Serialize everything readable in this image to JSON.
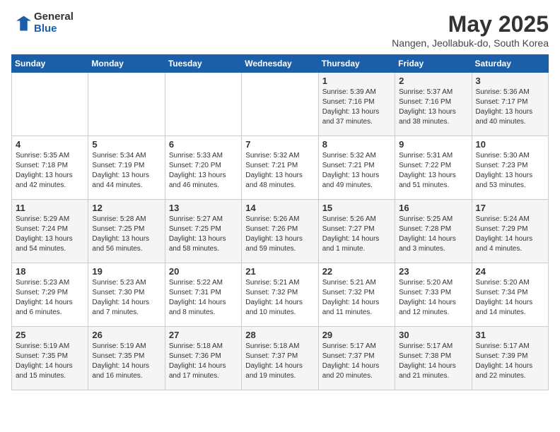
{
  "logo": {
    "general": "General",
    "blue": "Blue"
  },
  "title": "May 2025",
  "subtitle": "Nangen, Jeollabuk-do, South Korea",
  "days_header": [
    "Sunday",
    "Monday",
    "Tuesday",
    "Wednesday",
    "Thursday",
    "Friday",
    "Saturday"
  ],
  "weeks": [
    [
      {
        "day": "",
        "info": ""
      },
      {
        "day": "",
        "info": ""
      },
      {
        "day": "",
        "info": ""
      },
      {
        "day": "",
        "info": ""
      },
      {
        "day": "1",
        "info": "Sunrise: 5:39 AM\nSunset: 7:16 PM\nDaylight: 13 hours\nand 37 minutes."
      },
      {
        "day": "2",
        "info": "Sunrise: 5:37 AM\nSunset: 7:16 PM\nDaylight: 13 hours\nand 38 minutes."
      },
      {
        "day": "3",
        "info": "Sunrise: 5:36 AM\nSunset: 7:17 PM\nDaylight: 13 hours\nand 40 minutes."
      }
    ],
    [
      {
        "day": "4",
        "info": "Sunrise: 5:35 AM\nSunset: 7:18 PM\nDaylight: 13 hours\nand 42 minutes."
      },
      {
        "day": "5",
        "info": "Sunrise: 5:34 AM\nSunset: 7:19 PM\nDaylight: 13 hours\nand 44 minutes."
      },
      {
        "day": "6",
        "info": "Sunrise: 5:33 AM\nSunset: 7:20 PM\nDaylight: 13 hours\nand 46 minutes."
      },
      {
        "day": "7",
        "info": "Sunrise: 5:32 AM\nSunset: 7:21 PM\nDaylight: 13 hours\nand 48 minutes."
      },
      {
        "day": "8",
        "info": "Sunrise: 5:32 AM\nSunset: 7:21 PM\nDaylight: 13 hours\nand 49 minutes."
      },
      {
        "day": "9",
        "info": "Sunrise: 5:31 AM\nSunset: 7:22 PM\nDaylight: 13 hours\nand 51 minutes."
      },
      {
        "day": "10",
        "info": "Sunrise: 5:30 AM\nSunset: 7:23 PM\nDaylight: 13 hours\nand 53 minutes."
      }
    ],
    [
      {
        "day": "11",
        "info": "Sunrise: 5:29 AM\nSunset: 7:24 PM\nDaylight: 13 hours\nand 54 minutes."
      },
      {
        "day": "12",
        "info": "Sunrise: 5:28 AM\nSunset: 7:25 PM\nDaylight: 13 hours\nand 56 minutes."
      },
      {
        "day": "13",
        "info": "Sunrise: 5:27 AM\nSunset: 7:25 PM\nDaylight: 13 hours\nand 58 minutes."
      },
      {
        "day": "14",
        "info": "Sunrise: 5:26 AM\nSunset: 7:26 PM\nDaylight: 13 hours\nand 59 minutes."
      },
      {
        "day": "15",
        "info": "Sunrise: 5:26 AM\nSunset: 7:27 PM\nDaylight: 14 hours\nand 1 minute."
      },
      {
        "day": "16",
        "info": "Sunrise: 5:25 AM\nSunset: 7:28 PM\nDaylight: 14 hours\nand 3 minutes."
      },
      {
        "day": "17",
        "info": "Sunrise: 5:24 AM\nSunset: 7:29 PM\nDaylight: 14 hours\nand 4 minutes."
      }
    ],
    [
      {
        "day": "18",
        "info": "Sunrise: 5:23 AM\nSunset: 7:29 PM\nDaylight: 14 hours\nand 6 minutes."
      },
      {
        "day": "19",
        "info": "Sunrise: 5:23 AM\nSunset: 7:30 PM\nDaylight: 14 hours\nand 7 minutes."
      },
      {
        "day": "20",
        "info": "Sunrise: 5:22 AM\nSunset: 7:31 PM\nDaylight: 14 hours\nand 8 minutes."
      },
      {
        "day": "21",
        "info": "Sunrise: 5:21 AM\nSunset: 7:32 PM\nDaylight: 14 hours\nand 10 minutes."
      },
      {
        "day": "22",
        "info": "Sunrise: 5:21 AM\nSunset: 7:32 PM\nDaylight: 14 hours\nand 11 minutes."
      },
      {
        "day": "23",
        "info": "Sunrise: 5:20 AM\nSunset: 7:33 PM\nDaylight: 14 hours\nand 12 minutes."
      },
      {
        "day": "24",
        "info": "Sunrise: 5:20 AM\nSunset: 7:34 PM\nDaylight: 14 hours\nand 14 minutes."
      }
    ],
    [
      {
        "day": "25",
        "info": "Sunrise: 5:19 AM\nSunset: 7:35 PM\nDaylight: 14 hours\nand 15 minutes."
      },
      {
        "day": "26",
        "info": "Sunrise: 5:19 AM\nSunset: 7:35 PM\nDaylight: 14 hours\nand 16 minutes."
      },
      {
        "day": "27",
        "info": "Sunrise: 5:18 AM\nSunset: 7:36 PM\nDaylight: 14 hours\nand 17 minutes."
      },
      {
        "day": "28",
        "info": "Sunrise: 5:18 AM\nSunset: 7:37 PM\nDaylight: 14 hours\nand 19 minutes."
      },
      {
        "day": "29",
        "info": "Sunrise: 5:17 AM\nSunset: 7:37 PM\nDaylight: 14 hours\nand 20 minutes."
      },
      {
        "day": "30",
        "info": "Sunrise: 5:17 AM\nSunset: 7:38 PM\nDaylight: 14 hours\nand 21 minutes."
      },
      {
        "day": "31",
        "info": "Sunrise: 5:17 AM\nSunset: 7:39 PM\nDaylight: 14 hours\nand 22 minutes."
      }
    ]
  ]
}
